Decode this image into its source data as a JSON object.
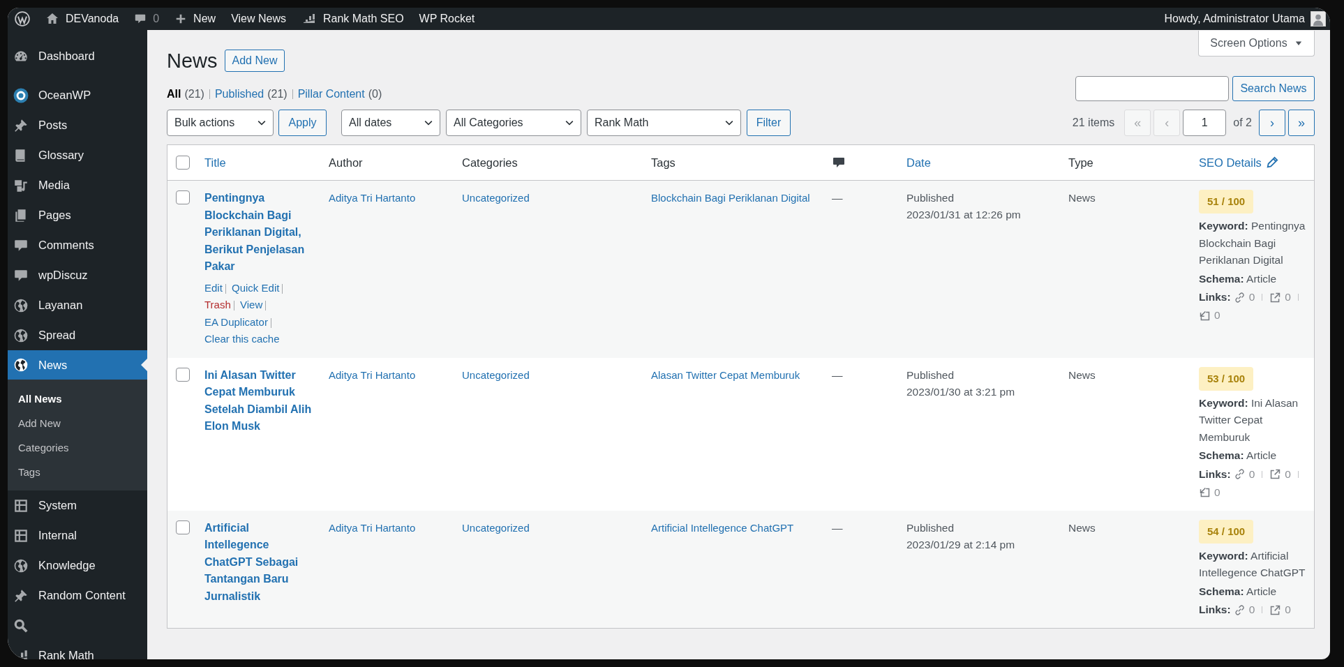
{
  "admin_bar": {
    "site": "DEVanoda",
    "comments": "0",
    "new": "New",
    "view": "View News",
    "rank_math": "Rank Math SEO",
    "wp_rocket": "WP Rocket",
    "greeting": "Howdy, Administrator Utama"
  },
  "sidebar": {
    "items": [
      {
        "label": "Dashboard",
        "kind": "gauge",
        "selected": false
      },
      {
        "label": "OceanWP",
        "kind": "ring",
        "selected": false
      },
      {
        "label": "Posts",
        "kind": "pin",
        "selected": false
      },
      {
        "label": "Glossary",
        "kind": "book",
        "selected": false
      },
      {
        "label": "Media",
        "kind": "media",
        "selected": false
      },
      {
        "label": "Pages",
        "kind": "pages",
        "selected": false
      },
      {
        "label": "Comments",
        "kind": "bubble",
        "selected": false
      },
      {
        "label": "wpDiscuz",
        "kind": "bubble",
        "selected": false
      },
      {
        "label": "Layanan",
        "kind": "globe",
        "selected": false
      },
      {
        "label": "Spread",
        "kind": "globe",
        "selected": false
      },
      {
        "label": "News",
        "kind": "globe",
        "selected": true,
        "submenu": [
          {
            "label": "All News",
            "selected": true
          },
          {
            "label": "Add New",
            "selected": false
          },
          {
            "label": "Categories",
            "selected": false
          },
          {
            "label": "Tags",
            "selected": false
          }
        ]
      },
      {
        "label": "System",
        "kind": "grid",
        "selected": false
      },
      {
        "label": "Internal",
        "kind": "grid",
        "selected": false
      },
      {
        "label": "Knowledge",
        "kind": "globe",
        "selected": false
      },
      {
        "label": "Random Content",
        "kind": "pin",
        "selected": false
      },
      {
        "kind": "search",
        "selected": false
      },
      {
        "label": "Rank Math",
        "kind": "chart",
        "selected": false
      }
    ]
  },
  "screen_options": "Screen Options",
  "page": {
    "title": "News",
    "add_new": "Add New"
  },
  "views": [
    {
      "label": "All",
      "count": "(21)",
      "selected": true
    },
    {
      "label": "Published",
      "count": "(21)",
      "selected": false
    },
    {
      "label": "Pillar Content",
      "count": "(0)",
      "selected": false
    }
  ],
  "search": {
    "button": "Search News"
  },
  "toolbar": {
    "bulk": "Bulk actions",
    "apply": "Apply",
    "filters": [
      "All dates",
      "All Categories",
      "Rank Math"
    ],
    "filter_button": "Filter"
  },
  "pagination": {
    "items": "21 items",
    "first": {
      "label": "«",
      "disabled": true
    },
    "prev": {
      "label": "‹",
      "disabled": true
    },
    "page": "1",
    "of": "of 2",
    "next": {
      "label": "›",
      "disabled": false
    },
    "last": {
      "label": "»",
      "disabled": false
    }
  },
  "table": {
    "columns": [
      {
        "kind": "check",
        "checked": false
      },
      {
        "kind": "text",
        "label": "Title",
        "sortable": true
      },
      {
        "kind": "text",
        "label": "Author",
        "sortable": false
      },
      {
        "kind": "text",
        "label": "Categories",
        "sortable": false
      },
      {
        "kind": "text",
        "label": "Tags",
        "sortable": false
      },
      {
        "kind": "comments"
      },
      {
        "kind": "text",
        "label": "Date",
        "sortable": true
      },
      {
        "kind": "text",
        "label": "Type",
        "sortable": false
      },
      {
        "kind": "seo",
        "label": "SEO Details",
        "sortable": true
      }
    ],
    "rows": [
      {
        "checked": false,
        "title": "Pentingnya Blockchain Bagi Periklanan Digital, Berikut Penjelasan Pakar",
        "actions": [
          {
            "label": "Edit",
            "kind": "link"
          },
          {
            "label": "Quick Edit",
            "kind": "link"
          },
          {
            "label": "Trash",
            "kind": "delete"
          },
          {
            "label": "View",
            "kind": "link"
          },
          {
            "label": "EA Duplicator",
            "kind": "link"
          },
          {
            "label": "Clear this cache",
            "kind": "link"
          }
        ],
        "author": "Aditya Tri Hartanto",
        "category": "Uncategorized",
        "tag": "Blockchain Bagi Periklanan Digital",
        "comments": "—",
        "status": "Published",
        "date": "2023/01/31 at 12:26 pm",
        "type": "News",
        "score": "51 / 100",
        "keyword_label": "Keyword:",
        "keyword": "Pentingnya Blockchain Bagi Periklanan Digital",
        "schema_label": "Schema:",
        "schema": "Article",
        "links_label": "Links:",
        "links": {
          "internal": "0",
          "external": "0",
          "incoming": "0"
        }
      },
      {
        "checked": false,
        "title": "Ini Alasan Twitter Cepat Memburuk Setelah Diambil Alih Elon Musk",
        "author": "Aditya Tri Hartanto",
        "category": "Uncategorized",
        "tag": "Alasan Twitter Cepat Memburuk",
        "comments": "—",
        "status": "Published",
        "date": "2023/01/30 at 3:21 pm",
        "type": "News",
        "score": "53 / 100",
        "keyword_label": "Keyword:",
        "keyword": "Ini Alasan Twitter Cepat Memburuk",
        "schema_label": "Schema:",
        "schema": "Article",
        "links_label": "Links:",
        "links": {
          "internal": "0",
          "external": "0",
          "incoming": "0"
        }
      },
      {
        "checked": false,
        "title": "Artificial Intellegence ChatGPT Sebagai Tantangan Baru Jurnalistik",
        "author": "Aditya Tri Hartanto",
        "category": "Uncategorized",
        "tag": "Artificial Intellegence ChatGPT",
        "comments": "—",
        "status": "Published",
        "date": "2023/01/29 at 2:14 pm",
        "type": "News",
        "score": "54 / 100",
        "keyword_label": "Keyword:",
        "keyword": "Artificial Intellegence ChatGPT",
        "schema_label": "Schema:",
        "schema": "Article",
        "links_label": "Links:",
        "links": {
          "internal": "0",
          "external": "0"
        }
      }
    ]
  }
}
